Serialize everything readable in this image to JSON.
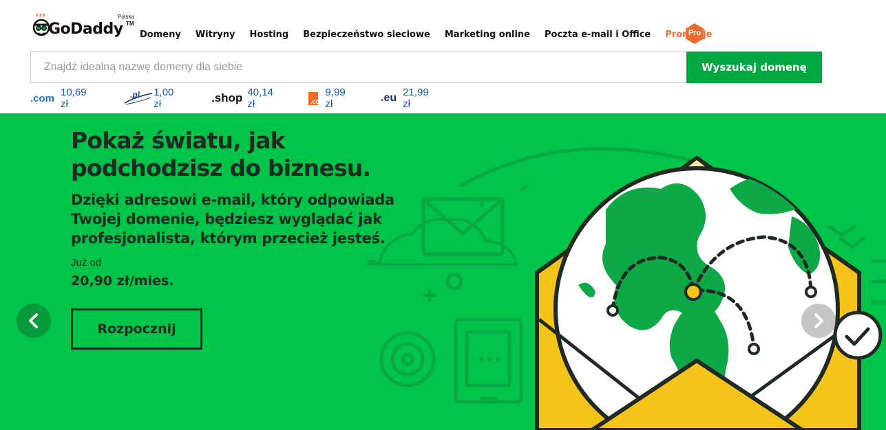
{
  "header": {
    "logo_text": "GoDaddy",
    "logo_country": "Polska",
    "logo_tm": "TM",
    "nav": [
      {
        "label": "Domeny"
      },
      {
        "label": "Witryny"
      },
      {
        "label": "Hosting"
      },
      {
        "label": "Bezpieczeństwo sieciowe"
      },
      {
        "label": "Marketing online"
      },
      {
        "label": "Poczta e-mail i Office"
      },
      {
        "label": "Promocje",
        "highlight": true
      }
    ],
    "pro_badge": "Pro"
  },
  "search": {
    "placeholder": "Znajdź idealną nazwę domeny dla siebie",
    "value": "",
    "button_label": "Wyszukaj domenę"
  },
  "tlds": [
    {
      "name": ".com",
      "price": "10,69 zł",
      "icon": "tld-com-logo",
      "color": "#1a76c7"
    },
    {
      "name": ".pl",
      "price": "1,00 zł",
      "icon": "tld-pl-logo",
      "color": "#1e3f8a"
    },
    {
      "name": ".shop",
      "price": "40,14 zł",
      "icon": "tld-shop-logo",
      "color": "#111111"
    },
    {
      "name": ".co",
      "price": "9,99 zł",
      "icon": "tld-co-logo",
      "color": "#f26b21"
    },
    {
      "name": ".eu",
      "price": "21,99 zł",
      "icon": "tld-eu-logo",
      "color": "#1b2f5a"
    }
  ],
  "hero": {
    "headline": "Pokaż światu, jak podchodzisz do biznesu.",
    "subheadline": "Dzięki adresowi e-mail, który odpowiada Twojej domenie, będziesz wyglądać jak profesjonalista, którym przecież jesteś.",
    "price_label": "Już od",
    "price_value": "20,90 zł/mies.",
    "cta_label": "Rozpocznij",
    "illustration": "envelope-globe-illustration",
    "prev_icon": "chevron-left-icon",
    "next_icon": "chevron-right-icon"
  },
  "colors": {
    "brand_green": "#00a63f",
    "hero_green": "#00c449",
    "promo_orange": "#ef6c2e",
    "envelope_yellow": "#f5c41b",
    "text_dark": "#1f2a22",
    "link_blue": "#1a56a7"
  }
}
